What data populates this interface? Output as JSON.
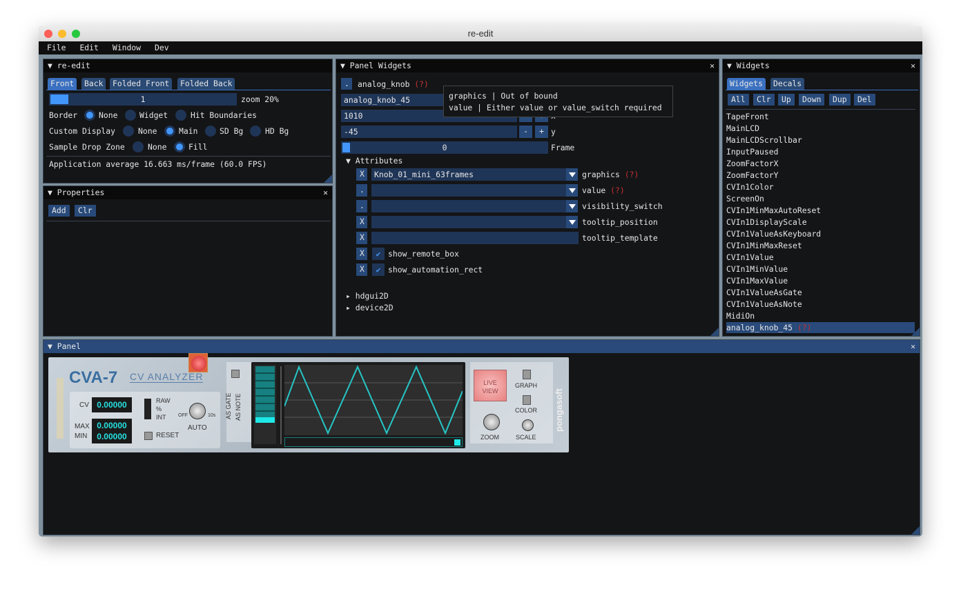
{
  "app": {
    "title": "re-edit"
  },
  "menu": [
    "File",
    "Edit",
    "Window",
    "Dev"
  ],
  "reedit": {
    "title": "re-edit",
    "tabs": [
      "Front",
      "Back",
      "Folded Front",
      "Folded Back"
    ],
    "active_tab": "Front",
    "zoom_value": "1",
    "zoom_label": "zoom 20%",
    "zoom_fraction": 0.04,
    "border_label": "Border",
    "border_options": [
      "None",
      "Widget",
      "Hit Boundaries"
    ],
    "border_selected": "None",
    "custom_label": "Custom Display",
    "custom_options": [
      "None",
      "Main",
      "SD Bg",
      "HD Bg"
    ],
    "custom_selected": "Main",
    "sample_label": "Sample Drop Zone",
    "sample_options": [
      "None",
      "Fill"
    ],
    "sample_selected": "Fill",
    "status": "Application average 16.663 ms/frame (60.0 FPS)"
  },
  "properties": {
    "title": "Properties",
    "add": "Add",
    "clr": "Clr"
  },
  "panel_widgets": {
    "title": "Panel Widgets",
    "dot": ".",
    "type": "analog_knob",
    "help": "(?)",
    "name": "analog_knob_45",
    "x": "1010",
    "y": "-45",
    "x_label": "x",
    "y_label": "y",
    "minus": "-",
    "plus": "+",
    "frame_value": "0",
    "frame_label": "Frame",
    "tooltip": [
      "graphics | Out of bound",
      "value | Either value or value_switch required"
    ],
    "attributes_label": "Attributes",
    "attributes": [
      {
        "btn": "X",
        "value": "Knob_01_mini_63frames",
        "label": "graphics",
        "help": "(?)",
        "kind": "combo"
      },
      {
        "btn": ".",
        "value": "",
        "label": "value",
        "help": "(?)",
        "kind": "combo"
      },
      {
        "btn": ".",
        "value": "",
        "label": "visibility_switch",
        "help": "",
        "kind": "combo"
      },
      {
        "btn": "X",
        "value": "",
        "label": "tooltip_position",
        "help": "",
        "kind": "combo"
      },
      {
        "btn": "X",
        "value": "",
        "label": "tooltip_template",
        "help": "",
        "kind": "text"
      },
      {
        "btn": "X",
        "value": "",
        "label": "show_remote_box",
        "help": "",
        "kind": "check",
        "checked": true
      },
      {
        "btn": "X",
        "value": "",
        "label": "show_automation_rect",
        "help": "",
        "kind": "check",
        "checked": true
      }
    ],
    "sections": [
      "hdgui2D",
      "device2D"
    ]
  },
  "widgets": {
    "title": "Widgets",
    "tabs": [
      "Widgets",
      "Decals"
    ],
    "active_tab": "Widgets",
    "buttons": [
      "All",
      "Clr",
      "Up",
      "Down",
      "Dup",
      "Del"
    ],
    "items": [
      "TapeFront",
      "MainLCD",
      "MainLCDScrollbar",
      "InputPaused",
      "ZoomFactorX",
      "ZoomFactorY",
      "CVIn1Color",
      "ScreenOn",
      "CVIn1MinMaxAutoReset",
      "CVIn1DisplayScale",
      "CVIn1ValueAsKeyboard",
      "CVIn1MinMaxReset",
      "CVIn1Value",
      "CVIn1MinValue",
      "CVIn1MaxValue",
      "CVIn1ValueAsGate",
      "CVIn1ValueAsNote",
      "MidiOn",
      "analog_knob_45"
    ],
    "selected": "analog_knob_45",
    "selected_help": "(?)"
  },
  "panel": {
    "title": "Panel",
    "device": {
      "name": "CVA-7",
      "subtitle": "CV ANALYZER",
      "cv_label": "CV",
      "cv": "0.00000",
      "max_label": "MAX",
      "max": "0.00000",
      "min_label": "MIN",
      "min": "0.00000",
      "raw": "RAW",
      "pct": "%",
      "int": "INT",
      "off": "OFF",
      "tens": "10s",
      "auto": "AUTO",
      "reset": "RESET",
      "as_gate": "AS GATE",
      "as_note": "AS NOTE",
      "live": "LIVE",
      "view": "VIEW",
      "graph": "GRAPH",
      "color": "COLOR",
      "zoom": "ZOOM",
      "scale": "SCALE",
      "brand": "pongasoft"
    }
  },
  "colors": {
    "accent": "#4296fa",
    "header_active": "#294a7a",
    "frame": "#1f3557",
    "error": "#c83232",
    "lcd": "#26c6c6"
  }
}
